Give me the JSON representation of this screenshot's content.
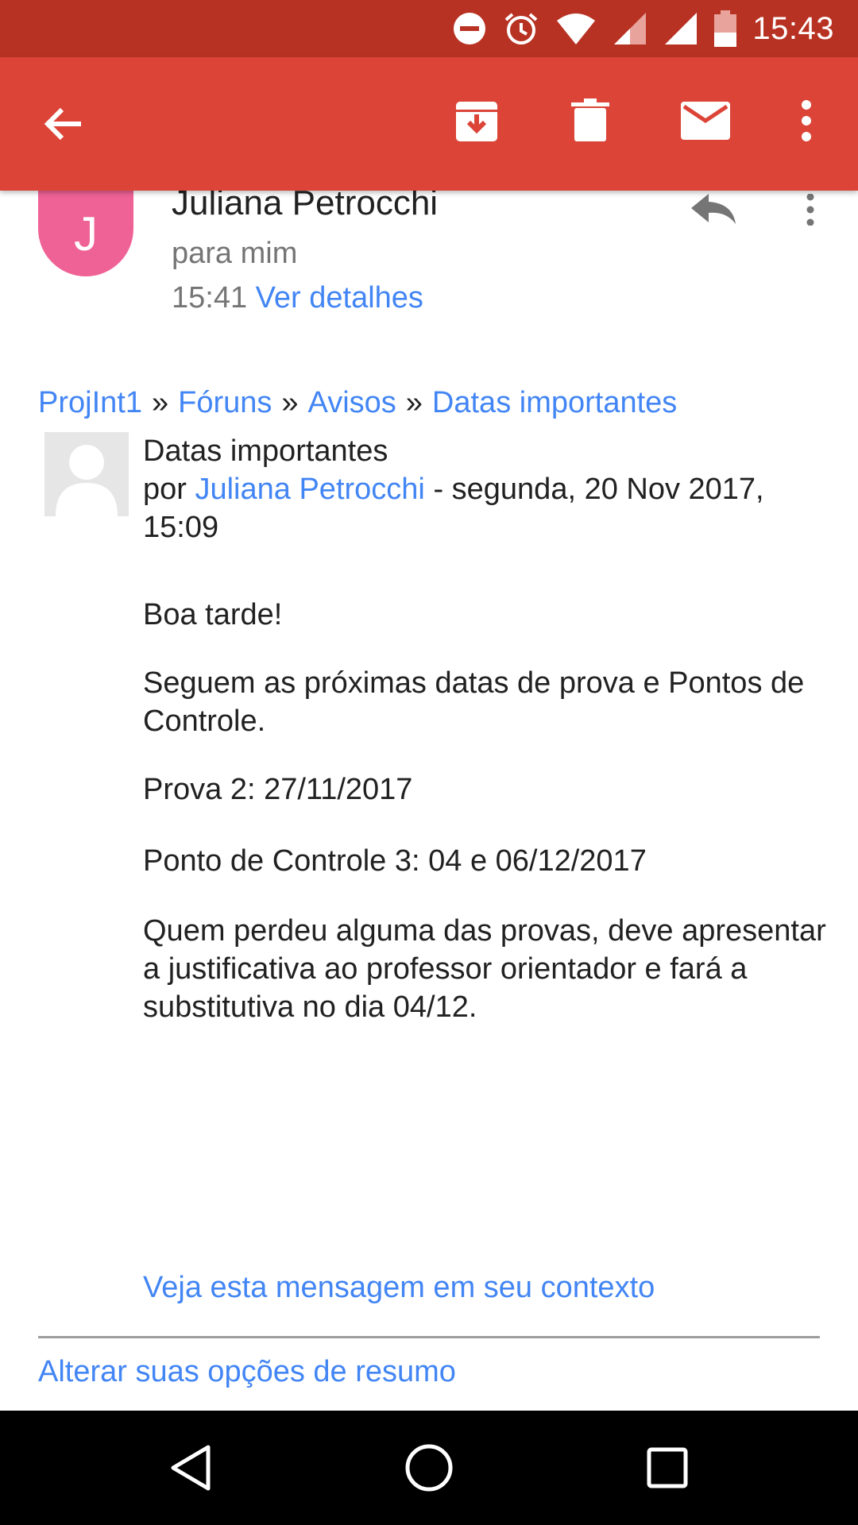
{
  "status_bar": {
    "time": "15:43",
    "icons": [
      "do-not-disturb-icon",
      "alarm-icon",
      "wifi-icon",
      "signal-icon",
      "signal-icon",
      "battery-icon"
    ]
  },
  "app_bar": {
    "icons": [
      "back-arrow-icon",
      "archive-icon",
      "delete-icon",
      "mark-unread-icon",
      "more-vert-icon"
    ]
  },
  "sender": {
    "avatar_letter": "J",
    "avatar_color": "#ef6295",
    "name": "Juliana Petrocchi",
    "to": "para mim",
    "time": "15:41",
    "details_link": "Ver detalhes"
  },
  "breadcrumb": {
    "items": [
      "ProjInt1",
      "Fóruns",
      "Avisos",
      "Datas importantes"
    ],
    "separator": "»"
  },
  "post": {
    "subject": "Datas importantes",
    "by_prefix": "por",
    "author": "Juliana Petrocchi",
    "date": "- segunda, 20 Nov 2017, 15:09"
  },
  "message": {
    "greeting": "Boa tarde!",
    "p1": "Seguem as próximas datas de prova e Pontos de Controle.",
    "p2": "Prova 2: 27/11/2017",
    "p3": "Ponto de Controle 3: 04 e 06/12/2017",
    "p4": "Quem perdeu alguma das provas, deve apresentar a justificativa ao professor orientador e fará a substitutiva no dia 04/12."
  },
  "footer": {
    "context_link": "Veja esta mensagem em seu contexto",
    "options_link": "Alterar suas opções de resumo"
  },
  "colors": {
    "status_bar": "#b83223",
    "app_bar": "#db4437",
    "link": "#4285f4"
  }
}
